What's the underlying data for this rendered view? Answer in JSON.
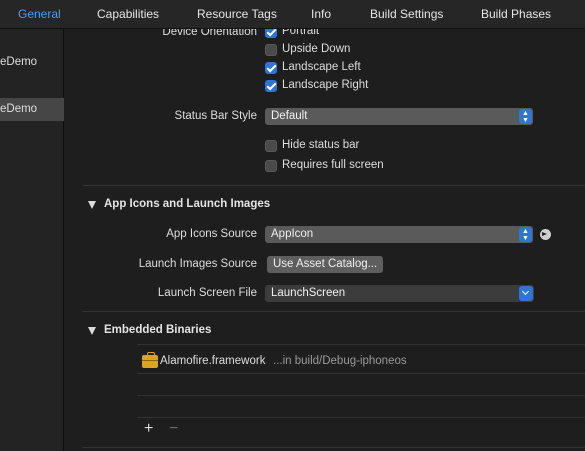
{
  "tabs": [
    {
      "label": "General",
      "active": true
    },
    {
      "label": "Capabilities"
    },
    {
      "label": "Resource Tags"
    },
    {
      "label": "Info"
    },
    {
      "label": "Build Settings"
    },
    {
      "label": "Build Phases"
    }
  ],
  "sidebar": {
    "items": [
      {
        "label": "eDemo",
        "selected": false
      },
      {
        "label": "eDemo",
        "selected": true
      }
    ]
  },
  "orientation": {
    "label": "Device Orientation",
    "options": [
      {
        "label": "Portrait",
        "checked": true
      },
      {
        "label": "Upside Down",
        "checked": false
      },
      {
        "label": "Landscape Left",
        "checked": true
      },
      {
        "label": "Landscape Right",
        "checked": true
      }
    ]
  },
  "status_bar": {
    "label": "Status Bar Style",
    "value": "Default",
    "hide_label": "Hide status bar",
    "hide_checked": false,
    "fullscreen_label": "Requires full screen",
    "fullscreen_checked": false
  },
  "app_icons": {
    "header": "App Icons and Launch Images",
    "icons_source_label": "App Icons Source",
    "icons_source_value": "AppIcon",
    "launch_images_label": "Launch Images Source",
    "launch_images_button": "Use Asset Catalog...",
    "launch_screen_label": "Launch Screen File",
    "launch_screen_value": "LaunchScreen"
  },
  "embedded": {
    "header": "Embedded Binaries",
    "items": [
      {
        "name": "Alamofire.framework",
        "path": "...in build/Debug-iphoneos"
      }
    ],
    "add_label": "+",
    "remove_label": "−"
  },
  "colors": {
    "accent": "#4b9bf5",
    "checkbox_on": "#2f75d6",
    "background": "#1e1e1e"
  }
}
